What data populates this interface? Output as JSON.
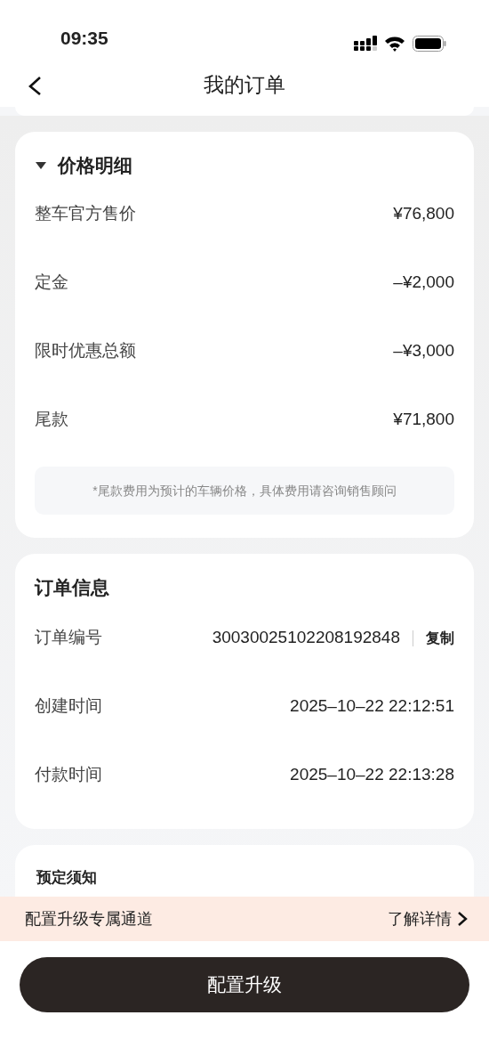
{
  "status_bar": {
    "time": "09:35"
  },
  "nav": {
    "title": "我的订单"
  },
  "price_details": {
    "title": "价格明细",
    "expanded": true,
    "rows": [
      {
        "label": "整车官方售价",
        "value": "¥76,800"
      },
      {
        "label": "定金",
        "value": "–¥2,000"
      },
      {
        "label": "限时优惠总额",
        "value": "–¥3,000"
      },
      {
        "label": "尾款",
        "value": "¥71,800"
      }
    ],
    "note": "*尾款费用为预计的车辆价格，具体费用请咨询销售顾问"
  },
  "order_info": {
    "title": "订单信息",
    "rows": [
      {
        "label": "订单编号",
        "value": "30030025102208192848",
        "action": "复制"
      },
      {
        "label": "创建时间",
        "value": "2025–10–22  22:12:51"
      },
      {
        "label": "付款时间",
        "value": "2025–10–22  22:13:28"
      }
    ]
  },
  "booking_notice": {
    "title": "预定须知"
  },
  "banner": {
    "text": "配置升级专属通道",
    "link": "了解详情"
  },
  "primary_button": "配置升级"
}
